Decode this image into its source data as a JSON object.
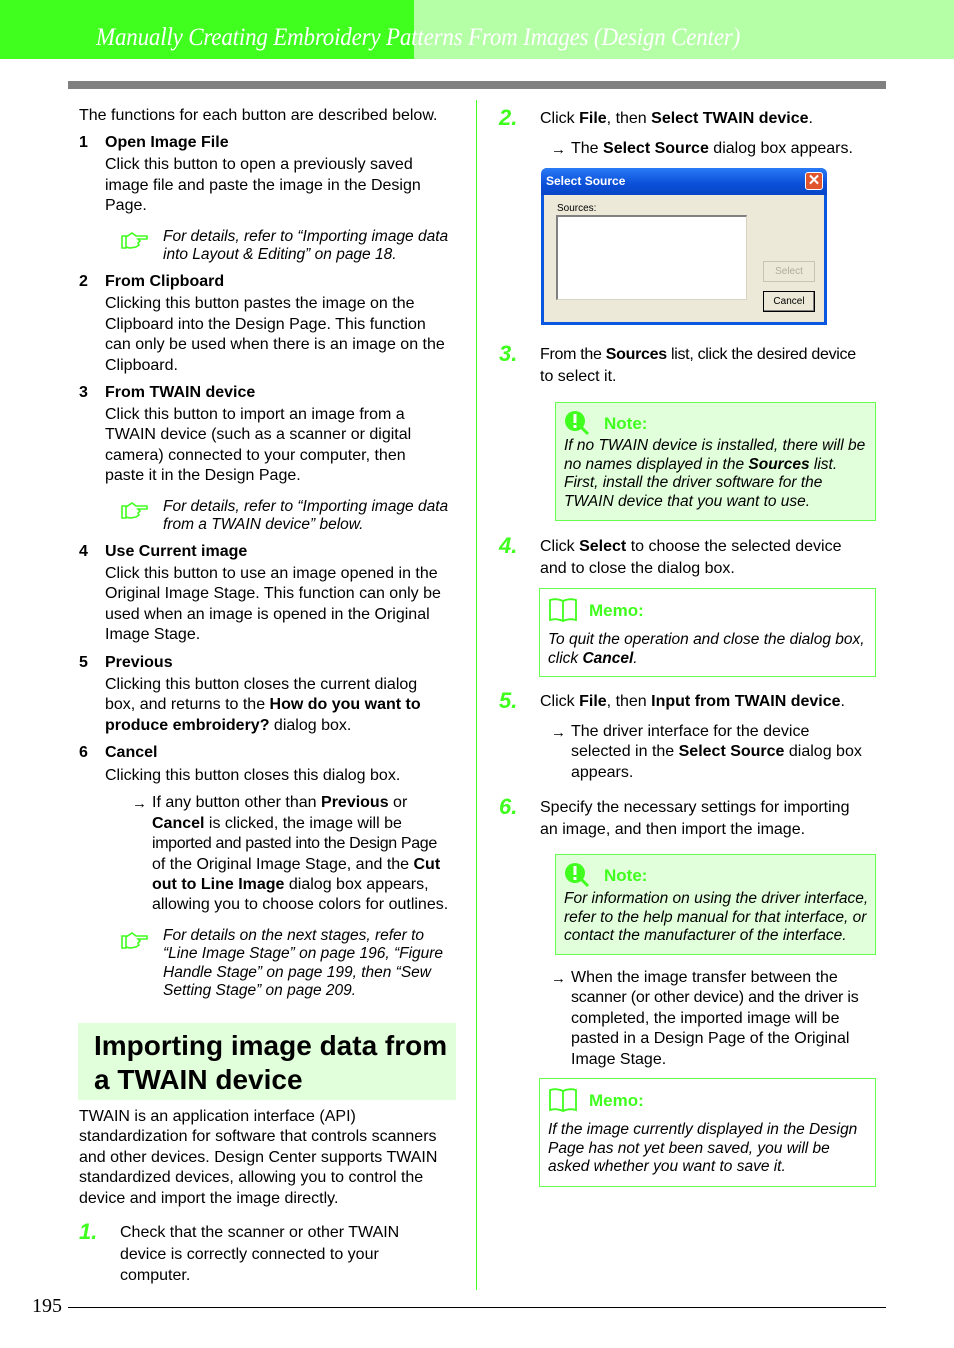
{
  "header": {
    "title": "Manually Creating Embroidery Patterns From Images (Design Center)"
  },
  "page_number": "195",
  "left": {
    "intro": "The functions for each button are described below.",
    "items": [
      {
        "num": "1",
        "title": "Open Image File",
        "lines": [
          "Click this button to open a previously saved",
          "image file and paste the image in the Design",
          "Page."
        ]
      },
      {
        "num": "2",
        "title": "From Clipboard",
        "lines": [
          "Clicking this button pastes the image on the",
          "Clipboard into the Design Page. This function",
          "can only be used when there is an image on the",
          "Clipboard."
        ]
      },
      {
        "num": "3",
        "title": "From TWAIN device",
        "lines": [
          "Click this button to import an image from a",
          "TWAIN device (such as a scanner or digital",
          "camera) connected to your computer, then",
          "paste it in the Design Page."
        ]
      },
      {
        "num": "4",
        "title": "Use Current image",
        "lines": [
          "Click this button to use an image opened in the",
          "Original Image Stage. This function can only be",
          "used when an image is opened in the Original",
          "Image Stage."
        ]
      },
      {
        "num": "5",
        "title": "Previous",
        "line1": "Clicking this button closes the current dialog",
        "line2a": "box, and returns to the ",
        "line2b": "How do you want to",
        "line3a": "produce embroidery?",
        "line3b": " dialog box."
      },
      {
        "num": "6",
        "title": "Cancel",
        "lines": [
          "Clicking this button closes this dialog box."
        ]
      }
    ],
    "refs": [
      {
        "lines": [
          "For details, refer to “Importing image data",
          "into Layout & Editing” on page 18."
        ]
      },
      {
        "lines": [
          "For details, refer to “Importing image data",
          "from a TWAIN device” below."
        ]
      },
      {
        "lines": [
          "For details on the next stages, refer to",
          "“Line Image Stage” on page 196, “Figure",
          "Handle Stage” on page 199, then “Sew",
          "Setting Stage” on page 209."
        ]
      }
    ],
    "result": {
      "l1a": "If any button other than ",
      "l1b": "Previous",
      "l1c": " or",
      "l2a": "Cancel",
      "l2b": " is clicked, the image will be",
      "l3": "imported and pasted into the Design Page",
      "l4a": "of the Original Image Stage, and the ",
      "l4b": "Cut",
      "l5a": "out to Line Image",
      "l5b": " dialog box appears,",
      "l6": "allowing you to choose colors for outlines."
    },
    "section_title_1": "Importing image data from",
    "section_title_2": "a TWAIN device",
    "twain_para": [
      "TWAIN is an application interface (API)",
      "standardization for software that controls scanners",
      "and other devices. Design Center supports TWAIN",
      "standardized devices, allowing you to control the",
      "device and import the image directly."
    ],
    "step1": {
      "num": "1.",
      "lines": [
        "Check that the scanner or other TWAIN",
        "device is correctly connected to your",
        "computer."
      ]
    }
  },
  "right": {
    "step2": {
      "num": "2.",
      "a": "Click ",
      "b": "File",
      "c": ", then ",
      "d": "Select TWAIN device",
      "e": ".",
      "res_a": "The ",
      "res_b": "Select Source",
      "res_c": " dialog box appears."
    },
    "dialog": {
      "title": "Select Source",
      "sources_label": "Sources:",
      "select_btn": "Select",
      "cancel_btn": "Cancel",
      "close": "✕"
    },
    "step3": {
      "num": "3.",
      "a": "From the ",
      "b": "Sources",
      "c": " list, click the desired device",
      "l2": "to select it."
    },
    "note1": {
      "label": "Note:",
      "l1": "If no TWAIN device is installed, there will be",
      "l2a": "no names displayed in the ",
      "l2b": "Sources",
      "l2c": " list.",
      "l3": "First, install the driver software for the",
      "l4": "TWAIN device that you want to use."
    },
    "step4": {
      "num": "4.",
      "a": "Click ",
      "b": "Select",
      "c": " to choose the selected device",
      "l2": "and to close the dialog box."
    },
    "memo1": {
      "label": "Memo:",
      "l1": "To quit the operation and close the dialog box,",
      "l2a": "click ",
      "l2b": "Cancel",
      "l2c": "."
    },
    "step5": {
      "num": "5.",
      "a": "Click ",
      "b": "File",
      "c": ", then ",
      "d": "Input from TWAIN device",
      "e": ".",
      "r1": "The driver interface for the device",
      "r2a": "selected in the ",
      "r2b": "Select Source",
      "r2c": " dialog box",
      "r3": "appears."
    },
    "step6": {
      "num": "6.",
      "l1": "Specify the necessary settings for importing",
      "l2": "an image, and then import the image."
    },
    "note2": {
      "label": "Note:",
      "lines": [
        "For information on using the driver interface,",
        "refer to the help manual for that interface, or",
        "contact the manufacturer of the interface."
      ]
    },
    "result6": [
      "When the image transfer between the",
      "scanner (or other device) and the driver is",
      "completed, the imported image will be",
      "pasted in a Design Page of the Original",
      "Image Stage."
    ],
    "memo2": {
      "label": "Memo:",
      "lines": [
        "If the image currently displayed in the Design",
        "Page has not yet been saved, you will be",
        "asked whether you want to save it."
      ]
    },
    "arrow": "→"
  }
}
